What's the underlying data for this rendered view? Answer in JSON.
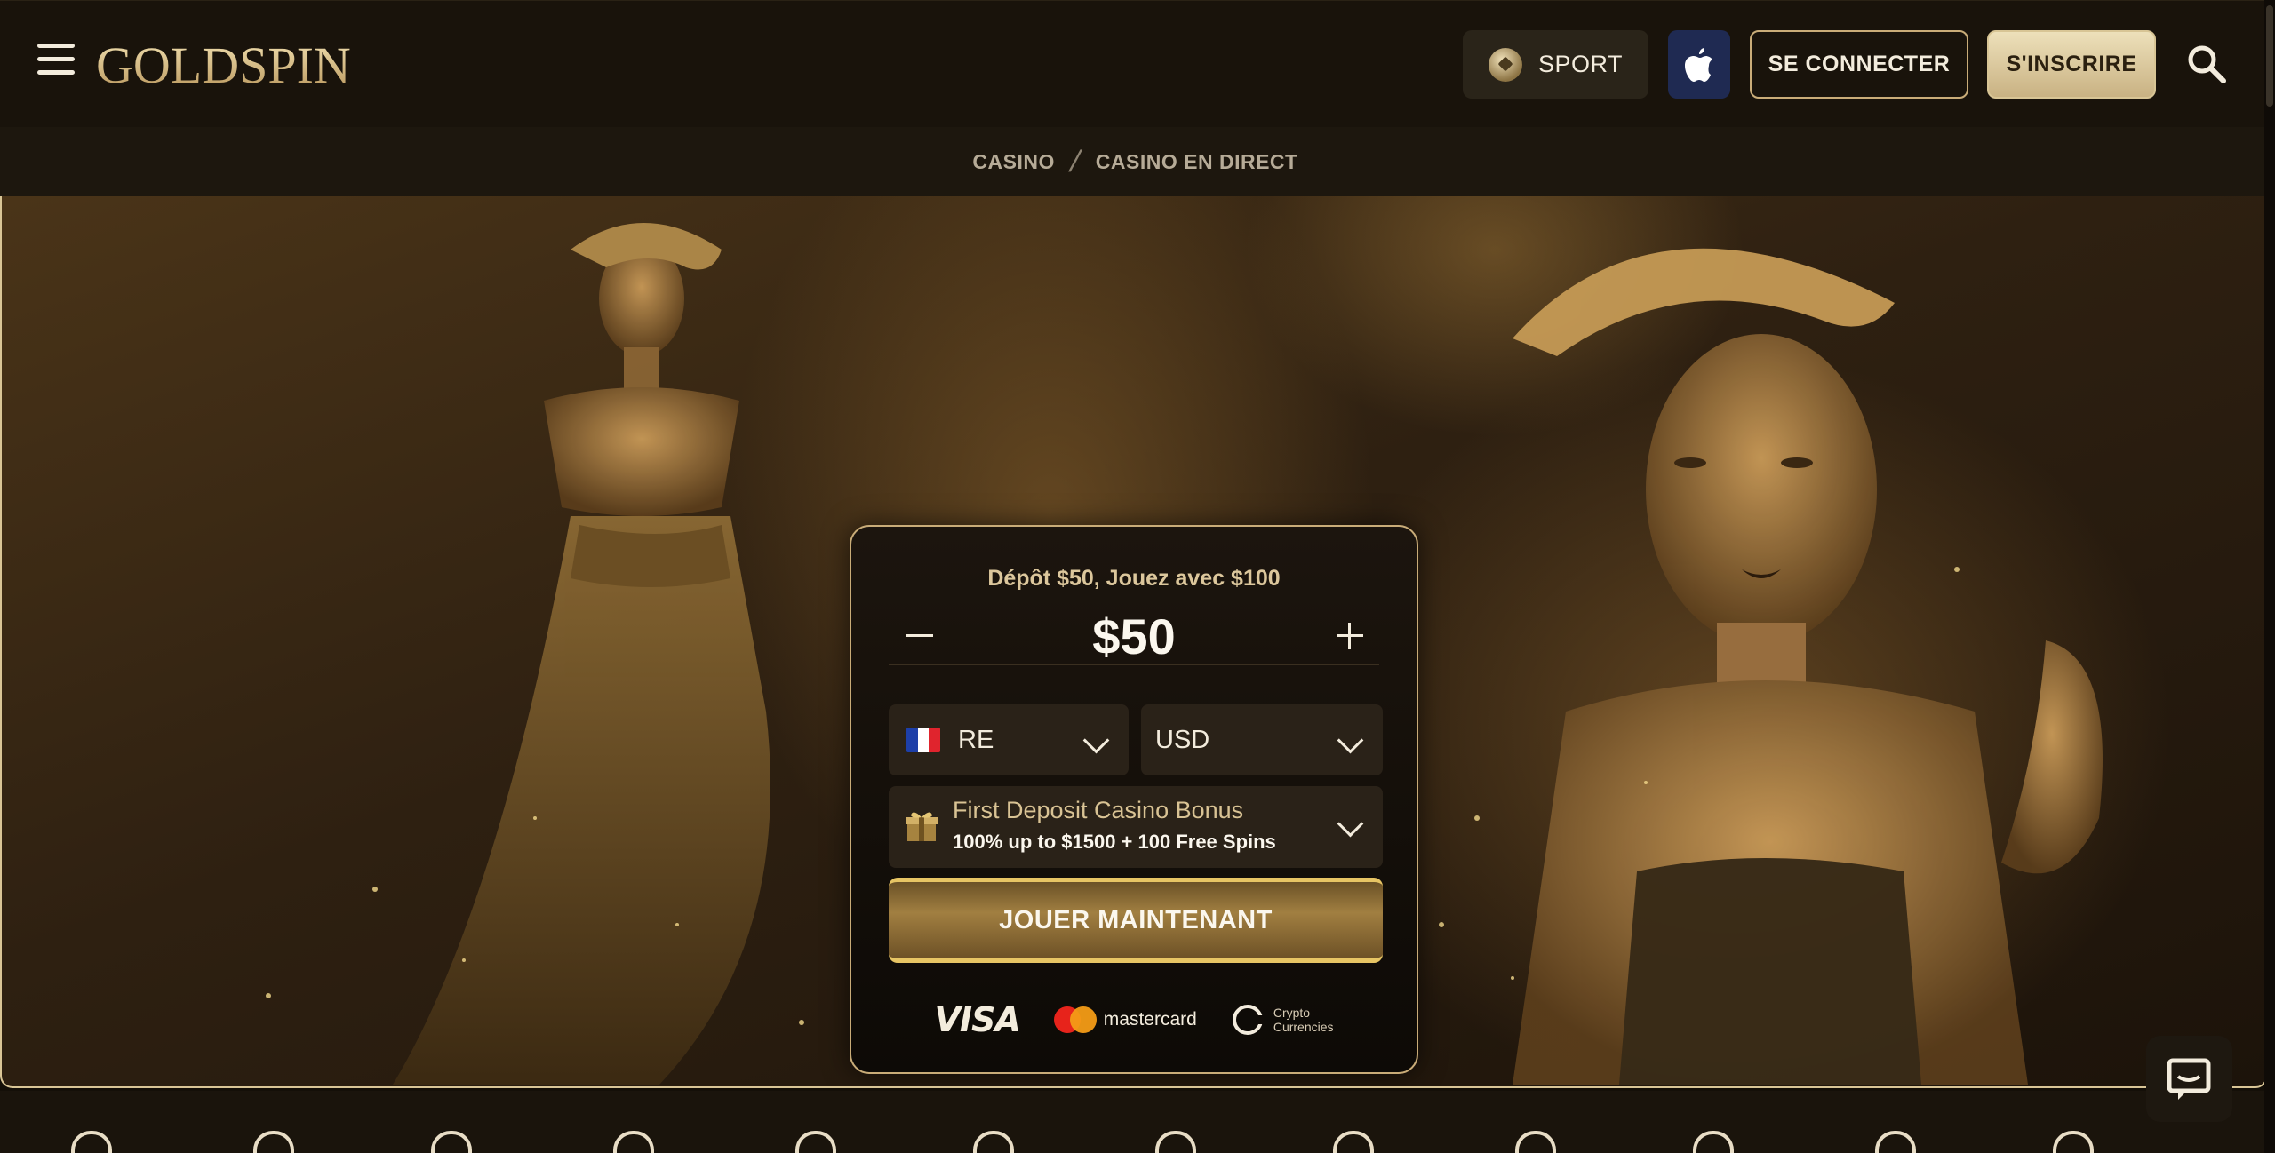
{
  "header": {
    "logo_text": "GOLDSPIN",
    "sport_label": "SPORT",
    "login_label": "SE CONNECTER",
    "signup_label": "S'INSCRIRE"
  },
  "breadcrumb": {
    "items": [
      "CASINO",
      "CASINO EN DIRECT"
    ],
    "separator": "/"
  },
  "deposit_card": {
    "title": "Dépôt $50, Jouez avec $100",
    "amount": "$50",
    "country_code": "RE",
    "currency": "USD",
    "bonus_title": "First Deposit Casino Bonus",
    "bonus_detail": "100% up to $1500 + 100 Free Spins",
    "play_button": "JOUER MAINTENANT",
    "payment_methods": {
      "visa": "VISA",
      "mastercard": "mastercard",
      "crypto_line1": "Crypto",
      "crypto_line2": "Currencies"
    }
  },
  "colors": {
    "gold_accent": "#c9ac78",
    "header_bg": "#19130b",
    "signup_bg": "#e4d4aa",
    "apple_button_bg": "#1f2a52"
  },
  "icons": [
    "menu-icon",
    "soccer-ball-icon",
    "apple-icon",
    "search-icon",
    "gift-icon",
    "chat-icon"
  ]
}
